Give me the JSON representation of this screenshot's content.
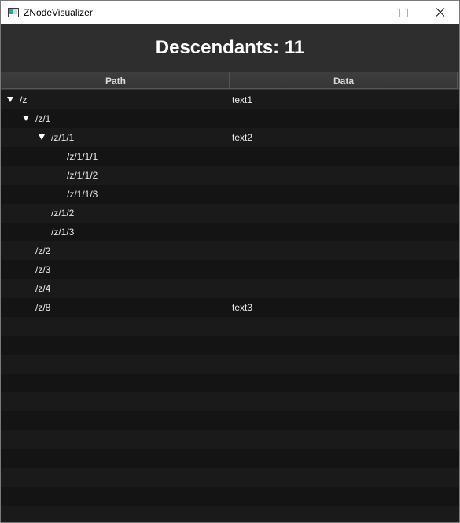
{
  "window": {
    "title": "ZNodeVisualizer",
    "controls": [
      "minimize",
      "maximize",
      "close"
    ]
  },
  "header": {
    "title": "Descendants: 11"
  },
  "table": {
    "columns": [
      "Path",
      "Data"
    ],
    "rows": [
      {
        "path": "/z",
        "data": "text1",
        "depth": 0,
        "expanded": true
      },
      {
        "path": "/z/1",
        "data": "",
        "depth": 1,
        "expanded": true
      },
      {
        "path": "/z/1/1",
        "data": "text2",
        "depth": 2,
        "expanded": true
      },
      {
        "path": "/z/1/1/1",
        "data": "",
        "depth": 3,
        "expanded": false
      },
      {
        "path": "/z/1/1/2",
        "data": "",
        "depth": 3,
        "expanded": false
      },
      {
        "path": "/z/1/1/3",
        "data": "",
        "depth": 3,
        "expanded": false
      },
      {
        "path": "/z/1/2",
        "data": "",
        "depth": 2,
        "expanded": false
      },
      {
        "path": "/z/1/3",
        "data": "",
        "depth": 2,
        "expanded": false
      },
      {
        "path": "/z/2",
        "data": "",
        "depth": 1,
        "expanded": false
      },
      {
        "path": "/z/3",
        "data": "",
        "depth": 1,
        "expanded": false
      },
      {
        "path": "/z/4",
        "data": "",
        "depth": 1,
        "expanded": false
      },
      {
        "path": "/z/8",
        "data": "text3",
        "depth": 1,
        "expanded": false
      }
    ]
  }
}
